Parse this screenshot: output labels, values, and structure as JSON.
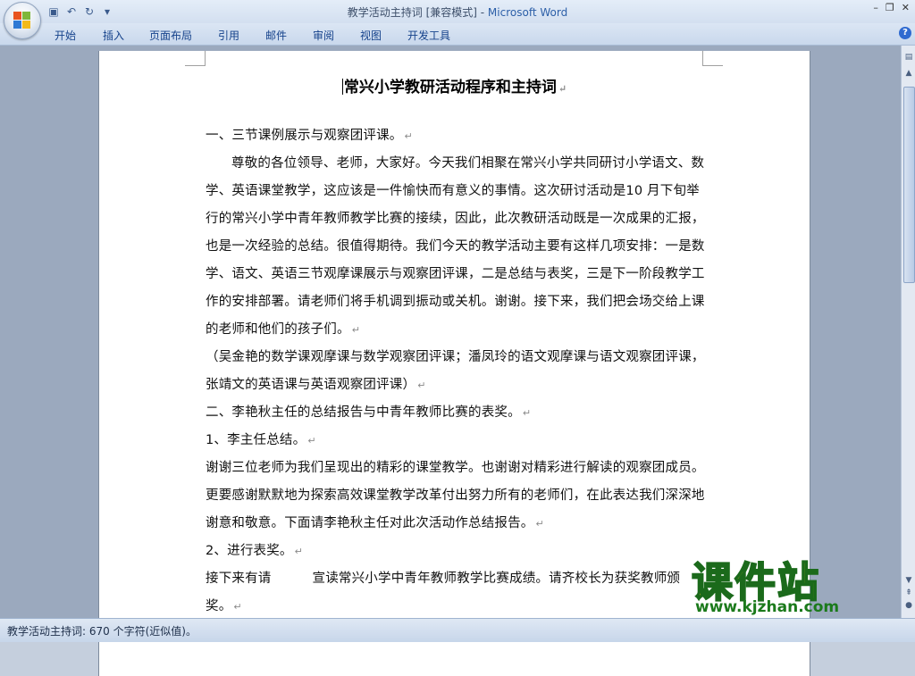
{
  "window": {
    "title_doc": "教学活动主持词 [兼容模式] - ",
    "title_app": "Microsoft Word"
  },
  "ribbon": {
    "tabs": [
      "开始",
      "插入",
      "页面布局",
      "引用",
      "邮件",
      "审阅",
      "视图",
      "开发工具"
    ]
  },
  "document": {
    "title": "常兴小学教研活动程序和主持词",
    "paragraphs": [
      "一、三节课例展示与观察团评课。",
      "尊敬的各位领导、老师，大家好。今天我们相聚在常兴小学共同研讨小学语文、数学、英语课堂教学，这应该是一件愉快而有意义的事情。这次研讨活动是10 月下旬举行的常兴小学中青年教师教学比赛的接续，因此，此次教研活动既是一次成果的汇报，也是一次经验的总结。很值得期待。我们今天的教学活动主要有这样几项安排：一是数学、语文、英语三节观摩课展示与观察团评课，二是总结与表奖，三是下一阶段教学工作的安排部署。请老师们将手机调到振动或关机。谢谢。接下来，我们把会场交给上课的老师和他们的孩子们。",
      "（吴金艳的数学课观摩课与数学观察团评课；潘凤玲的语文观摩课与语文观察团评课，张靖文的英语课与英语观察团评课）",
      "二、李艳秋主任的总结报告与中青年教师比赛的表奖。",
      "1、李主任总结。",
      "谢谢三位老师为我们呈现出的精彩的课堂教学。也谢谢对精彩进行解读的观察团成员。更要感谢默默地为探索高效课堂教学改革付出努力所有的老师们，在此表达我们深深地谢意和敬意。下面请李艳秋主任对此次活动作总结报告。",
      "2、进行表奖。",
      "接下来有请",
      "宣读常兴小学中青年教师教学比赛成绩。请齐校长为获奖教师颁奖。"
    ]
  },
  "status": {
    "text": "教学活动主持词: 670 个字符(近似值)。"
  },
  "watermark": {
    "big": "课件站",
    "url": "www.kjzhan.com"
  }
}
